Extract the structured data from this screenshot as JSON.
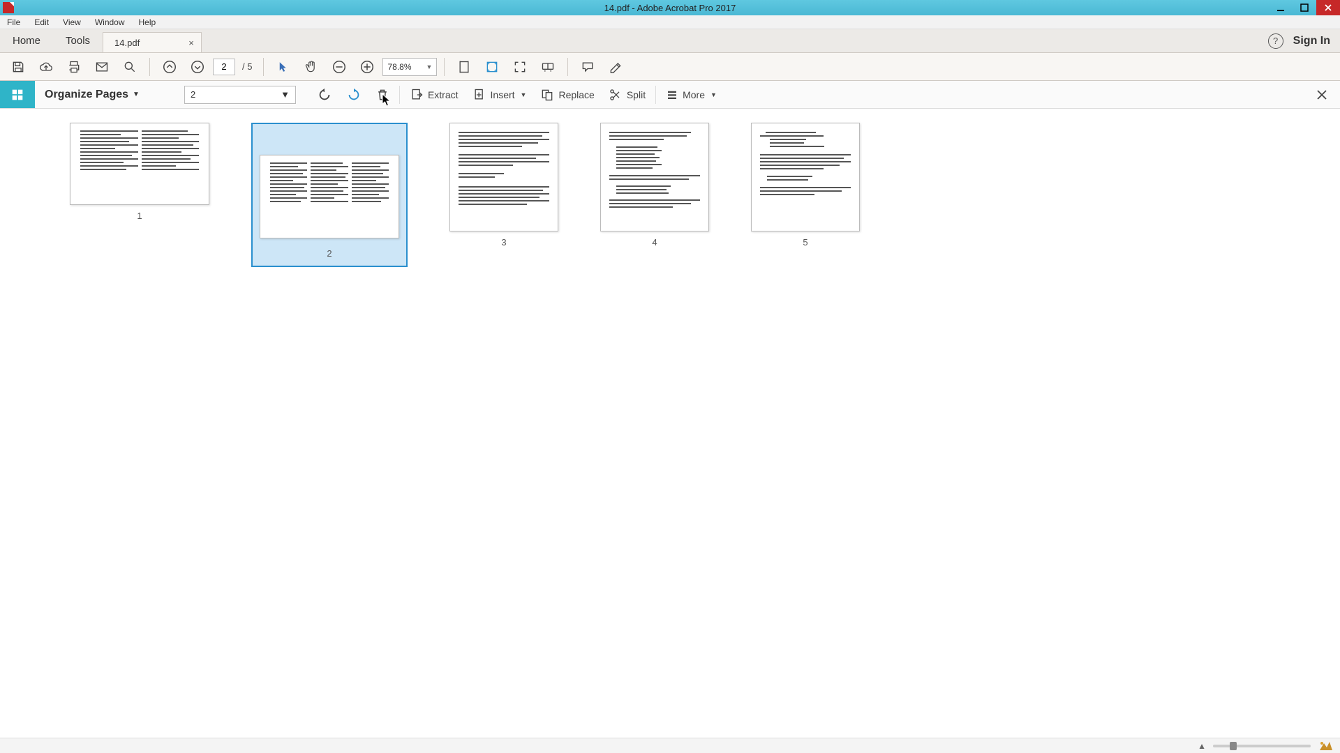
{
  "window": {
    "title": "14.pdf - Adobe Acrobat Pro 2017"
  },
  "menubar": {
    "items": [
      "File",
      "Edit",
      "View",
      "Window",
      "Help"
    ]
  },
  "tabstrip": {
    "home": "Home",
    "tools": "Tools",
    "doc_tab": "14.pdf",
    "signin": "Sign In"
  },
  "main_toolbar": {
    "page_current": "2",
    "page_total": "/  5",
    "zoom": "78.8%"
  },
  "organize_toolbar": {
    "title": "Organize Pages",
    "page_select": "2",
    "extract": "Extract",
    "insert": "Insert",
    "replace": "Replace",
    "split": "Split",
    "more": "More"
  },
  "thumbnails": {
    "labels": [
      "1",
      "2",
      "3",
      "4",
      "5"
    ],
    "selected_index": 1
  }
}
